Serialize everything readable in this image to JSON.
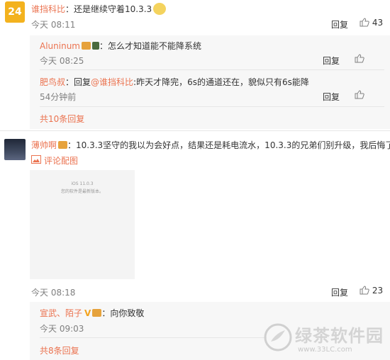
{
  "comments": [
    {
      "badge": "24",
      "name": "谁挡科比",
      "text": "：还是继续守着10.3.3",
      "time": "今天 08:11",
      "reply_label": "回复",
      "like_count": "43",
      "replies": [
        {
          "name": "Aluninum",
          "text": "：怎么才知道能不能降系统",
          "time": "今天 08:25",
          "reply_label": "回复"
        },
        {
          "name": "肥鸟叔",
          "prefix": "：回复",
          "mention": "@谁挡科比",
          "text": ":昨天才降完，6s的通道还在，貌似只有6s能降",
          "time": "54分钟前",
          "reply_label": "回复"
        }
      ],
      "more": "共10条回复"
    },
    {
      "name": "薄帅啊",
      "text": "：10.3.3坚守的我以为会好点，结果还是耗电流水，10.3.3的兄弟们别升级，我后悔了",
      "image_link": "评论配图",
      "image_lines": [
        "iOS 11.0.3",
        "您的软件是最新版本。"
      ],
      "time": "今天 08:18",
      "reply_label": "回复",
      "like_count": "23",
      "replies": [
        {
          "name": "宣武、陌子",
          "text": "：向你致敬",
          "time": "今天 09:03"
        }
      ],
      "more": "共8条回复"
    }
  ],
  "watermark": {
    "title": "绿茶软件园",
    "url": "www.33LC.com"
  },
  "colors": {
    "name": "#eb7350",
    "badge": "#f3b21e",
    "reply_bg": "#f7f7f7"
  }
}
